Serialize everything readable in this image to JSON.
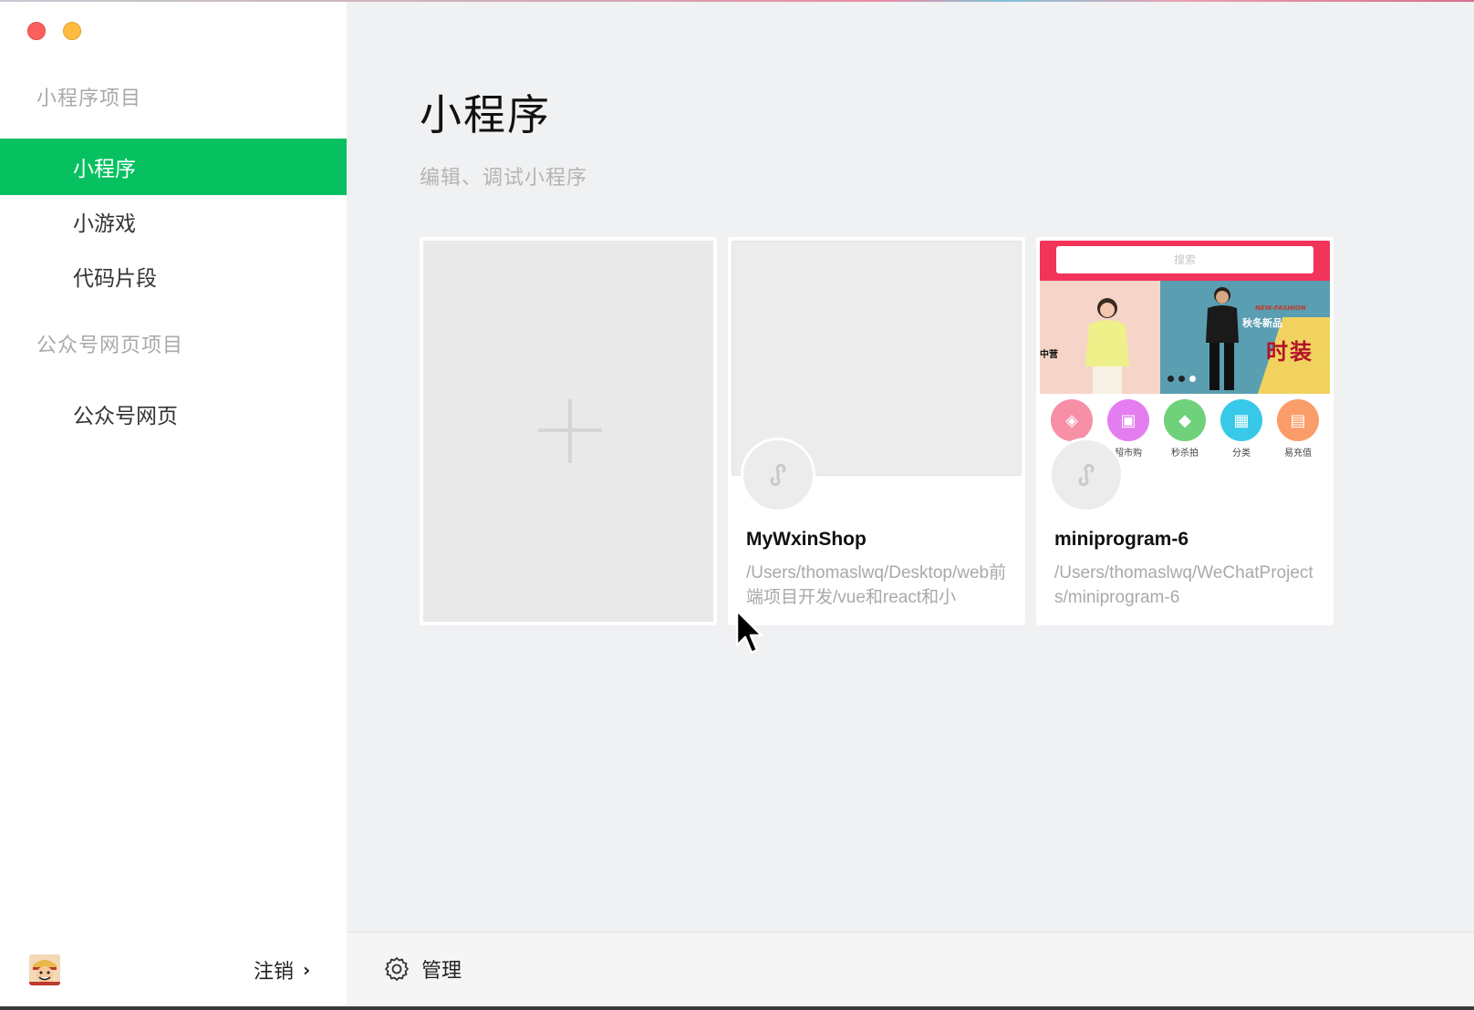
{
  "sidebar": {
    "window_controls": [
      "close",
      "minimize"
    ],
    "section_miniprogram": "小程序项目",
    "section_official": "公众号网页项目",
    "items": [
      {
        "label": "小程序",
        "active": true
      },
      {
        "label": "小游戏",
        "active": false
      },
      {
        "label": "代码片段",
        "active": false
      },
      {
        "label": "公众号网页",
        "active": false
      }
    ],
    "logout_label": "注销",
    "logout_chevron": "›"
  },
  "main": {
    "title": "小程序",
    "subtitle": "编辑、调试小程序",
    "projects": [
      {
        "name": "MyWxinShop",
        "path": "/Users/thomaslwq/Desktop/web前端项目开发/vue和react和小"
      },
      {
        "name": "miniprogram-6",
        "path": "/Users/thomaslwq/WeChatProjects/miniprogram-6"
      }
    ],
    "preview": {
      "search_placeholder": "搜索",
      "banner_tag_small": "NEW-FASHION",
      "banner_tag_season": "秋冬新品",
      "banner_tag_big": "时装",
      "banner_tag_left": "中营",
      "icons": [
        {
          "label": "",
          "color": "#f78fa6"
        },
        {
          "label": "超市购",
          "color": "#e47ef0"
        },
        {
          "label": "秒杀拍",
          "color": "#6fd17a"
        },
        {
          "label": "分类",
          "color": "#38c9e8"
        },
        {
          "label": "易充值",
          "color": "#fb9d6a"
        }
      ]
    }
  },
  "bottom": {
    "manage_label": "管理"
  },
  "colors": {
    "accent_green": "#07c160",
    "close_red": "#fc605c",
    "minimize_yellow": "#fdbc40"
  }
}
